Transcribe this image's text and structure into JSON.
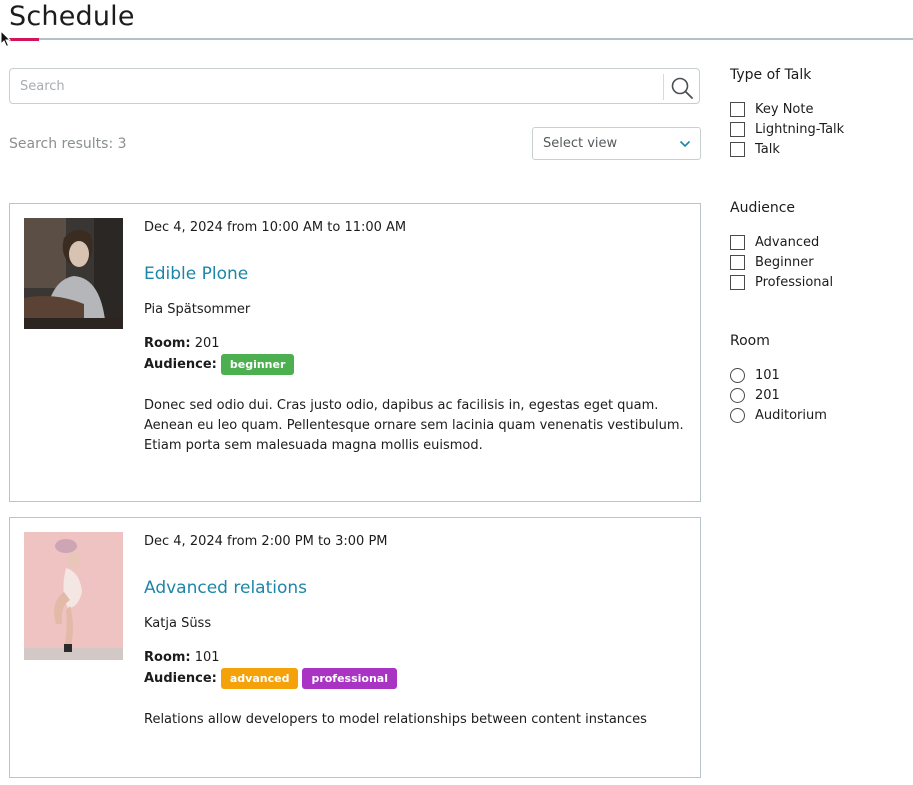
{
  "page": {
    "title": "Schedule"
  },
  "search": {
    "placeholder": "Search",
    "value": ""
  },
  "results": {
    "text": "Search results: 3"
  },
  "view_select": {
    "selected": "Select view"
  },
  "labels": {
    "room": "Room:",
    "audience": "Audience:"
  },
  "talks": [
    {
      "date": "Dec 4, 2024 from 10:00 AM to 11:00 AM",
      "title": "Edible Plone",
      "speaker": "Pia Spätsommer",
      "room": "201",
      "audience": [
        {
          "label": "beginner",
          "color": "#4caf50"
        }
      ],
      "description": "Donec sed odio dui. Cras justo odio, dapibus ac facilisis in, egestas eget quam. Aenean eu leo quam. Pellentesque ornare sem lacinia quam venenatis vestibulum. Etiam porta sem malesuada magna mollis euismod."
    },
    {
      "date": "Dec 4, 2024 from 2:00 PM to 3:00 PM",
      "title": "Advanced relations",
      "speaker": "Katja Süss",
      "room": "101",
      "audience": [
        {
          "label": "advanced",
          "color": "#f5a20a"
        },
        {
          "label": "professional",
          "color": "#a934c4"
        }
      ],
      "description": "Relations allow developers to model relationships between content instances"
    }
  ],
  "filters": {
    "type_of_talk": {
      "title": "Type of Talk",
      "options": [
        "Key Note",
        "Lightning-Talk",
        "Talk"
      ]
    },
    "audience": {
      "title": "Audience",
      "options": [
        "Advanced",
        "Beginner",
        "Professional"
      ]
    },
    "room": {
      "title": "Room",
      "options": [
        "101",
        "201",
        "Auditorium"
      ]
    }
  },
  "colors": {
    "accent": "#d4145a",
    "link": "#1d86a8",
    "border": "#b9c6c9"
  }
}
